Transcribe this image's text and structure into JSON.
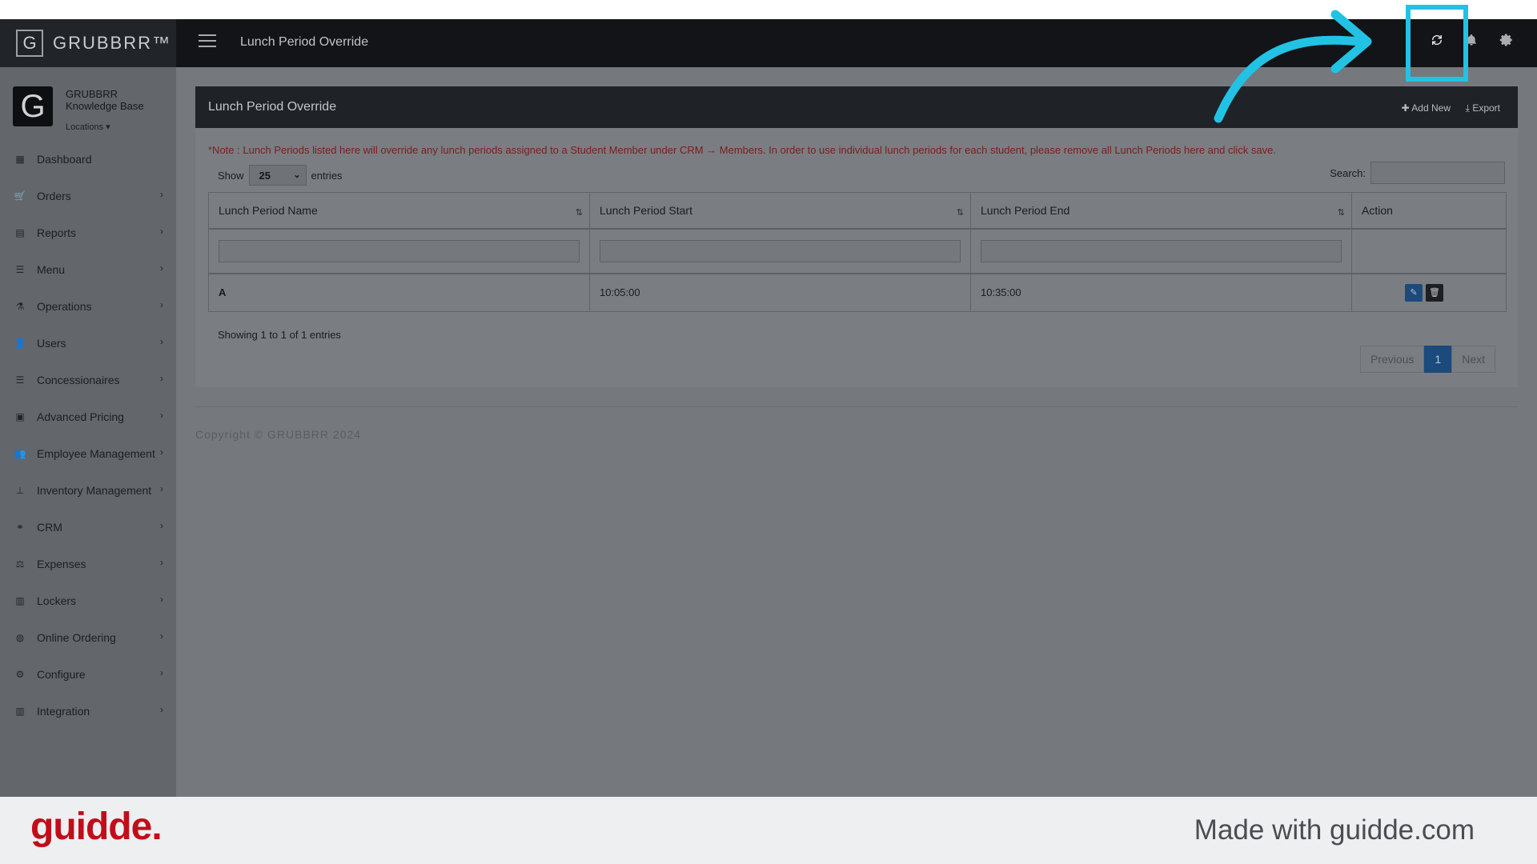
{
  "app": {
    "brand": "GRUBBRR™",
    "logo_letter": "G"
  },
  "topbar": {
    "page_title": "Lunch Period Override",
    "icons": [
      "menu-icon",
      "refresh-icon",
      "bell-icon",
      "gear-icon"
    ]
  },
  "profile": {
    "avatar_letter": "G",
    "org_line1": "GRUBBRR",
    "org_line2": "Knowledge Base",
    "locations_label": "Locations"
  },
  "sidebar": {
    "items": [
      {
        "label": "Dashboard",
        "icon": "dashboard-icon",
        "glyph": "▦",
        "has_children": false
      },
      {
        "label": "Orders",
        "icon": "cart-icon",
        "glyph": "🛒",
        "has_children": true
      },
      {
        "label": "Reports",
        "icon": "file-icon",
        "glyph": "▤",
        "has_children": true
      },
      {
        "label": "Menu",
        "icon": "list-icon",
        "glyph": "☰",
        "has_children": true
      },
      {
        "label": "Operations",
        "icon": "flask-icon",
        "glyph": "⚗",
        "has_children": true
      },
      {
        "label": "Users",
        "icon": "user-plus-icon",
        "glyph": "👤",
        "has_children": true
      },
      {
        "label": "Concessionaires",
        "icon": "list-icon",
        "glyph": "☰",
        "has_children": true
      },
      {
        "label": "Advanced Pricing",
        "icon": "money-icon",
        "glyph": "▣",
        "has_children": true
      },
      {
        "label": "Employee Management",
        "icon": "users-icon",
        "glyph": "👥",
        "has_children": true
      },
      {
        "label": "Inventory Management",
        "icon": "sitemap-icon",
        "glyph": "⊥",
        "has_children": true
      },
      {
        "label": "CRM",
        "icon": "link-icon",
        "glyph": "⚭",
        "has_children": true
      },
      {
        "label": "Expenses",
        "icon": "scale-icon",
        "glyph": "⚖",
        "has_children": true
      },
      {
        "label": "Lockers",
        "icon": "lockers-icon",
        "glyph": "▥",
        "has_children": true
      },
      {
        "label": "Online Ordering",
        "icon": "globe-icon",
        "glyph": "◍",
        "has_children": true
      },
      {
        "label": "Configure",
        "icon": "cog-icon",
        "glyph": "⚙",
        "has_children": true
      },
      {
        "label": "Integration",
        "icon": "integration-icon",
        "glyph": "▥",
        "has_children": true
      }
    ]
  },
  "panel": {
    "title": "Lunch Period Override",
    "add_new": "Add New",
    "export": "Export",
    "note": "*Note : Lunch Periods listed here will override any lunch periods assigned to a Student Member under CRM → Members. In order to use individual lunch periods for each student, please remove all Lunch Periods here and click save.",
    "show_label": "Show",
    "page_size": "25",
    "entries_label": "entries",
    "search_label": "Search:",
    "columns": [
      "Lunch Period Name",
      "Lunch Period Start",
      "Lunch Period End",
      "Action"
    ],
    "rows": [
      {
        "name": "A",
        "start": "10:05:00",
        "end": "10:35:00"
      }
    ],
    "info": "Showing 1 to 1 of 1 entries",
    "pager": {
      "previous": "Previous",
      "current": "1",
      "next": "Next"
    }
  },
  "footer": {
    "copyright": "Copyright © GRUBBRR 2024"
  },
  "guidde": {
    "logo": "guidde.",
    "made_with": "Made with guidde.com"
  },
  "colors": {
    "highlight": "#22c2e4",
    "guidde_red": "#c10d1a",
    "primary": "#1b4a7c"
  }
}
